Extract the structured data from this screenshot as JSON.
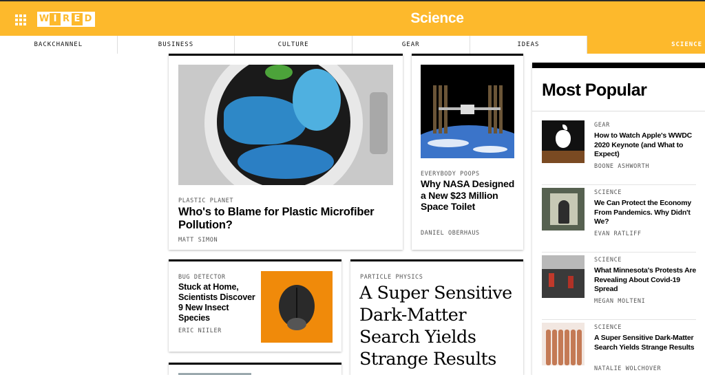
{
  "header": {
    "logo_letters": [
      "W",
      "I",
      "R",
      "E",
      "D"
    ],
    "section_title": "Science",
    "brand_color": "#fdb92c",
    "menu_icon": "grid-menu-icon"
  },
  "nav": {
    "items": [
      {
        "label": "BACKCHANNEL",
        "active": false
      },
      {
        "label": "BUSINESS",
        "active": false
      },
      {
        "label": "CULTURE",
        "active": false
      },
      {
        "label": "GEAR",
        "active": false
      },
      {
        "label": "IDEAS",
        "active": false
      },
      {
        "label": "SCIENCE",
        "active": true
      }
    ]
  },
  "stories": {
    "plastic": {
      "kicker": "PLASTIC PLANET",
      "headline": "Who's to Blame for Plastic Microfiber Pollution?",
      "byline": "MATT SIMON"
    },
    "nasa": {
      "kicker": "EVERYBODY POOPS",
      "headline": "Why NASA Designed a New $23 Million Space Toilet",
      "byline": "DANIEL OBERHAUS"
    },
    "bugs": {
      "kicker": "BUG DETECTOR",
      "headline": "Stuck at Home, Scientists Discover 9 New Insect Species",
      "byline": "ERIC NIILER"
    },
    "darkmatter": {
      "kicker": "PARTICLE PHYSICS",
      "headline": "A Super Sensitive Dark-Matter Search Yields Strange Results"
    }
  },
  "most_popular": {
    "title": "Most Popular",
    "items": [
      {
        "kicker": "GEAR",
        "headline": "How to Watch Apple's WWDC 2020 Keynote (and What to Expect)",
        "byline": "BOONE ASHWORTH"
      },
      {
        "kicker": "SCIENCE",
        "headline": "We Can Protect the Economy From Pandemics. Why Didn't We?",
        "byline": "EVAN RATLIFF"
      },
      {
        "kicker": "SCIENCE",
        "headline": "What Minnesota's Protests Are Revealing About Covid-19 Spread",
        "byline": "MEGAN MOLTENI"
      },
      {
        "kicker": "SCIENCE",
        "headline": "A Super Sensitive Dark-Matter Search Yields Strange Results",
        "byline": "NATALIE WOLCHOVER"
      }
    ]
  }
}
